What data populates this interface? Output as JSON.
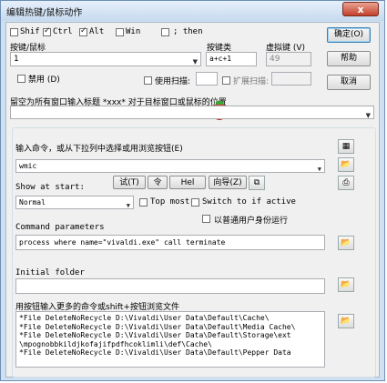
{
  "window": {
    "title": "编辑热键/鼠标动作",
    "close_glyph": "x"
  },
  "modifiers": {
    "shift": {
      "label": "Shif",
      "checked": false
    },
    "ctrl": {
      "label": "Ctrl",
      "checked": true
    },
    "alt": {
      "label": "Alt",
      "checked": true
    },
    "win": {
      "label": "Win",
      "checked": false
    },
    "extra": {
      "label": "; then",
      "checked": false
    }
  },
  "hotkey": {
    "label": "按键/鼠标",
    "value": "1"
  },
  "keyclass": {
    "label": "按键类",
    "value": "a+c+1"
  },
  "virtualkey": {
    "label": "虚拟键 (V)",
    "value": "49"
  },
  "disable": {
    "label": "禁用 (D)"
  },
  "use_scan": {
    "label": "使用扫描:"
  },
  "ext_scan": {
    "label": "扩展扫描:"
  },
  "buttons": {
    "ok": "确定(O)",
    "help": "帮助",
    "cancel": "取消"
  },
  "target": {
    "label": "留空为所有窗口输入标题 *xxx* 对于目标窗口或鼠标的位置",
    "value": ""
  },
  "command": {
    "label": "输入命令，或从下拉列中选择或用浏览按钮(E)",
    "value": "wmic"
  },
  "show": {
    "label": "Show at start:",
    "value": "Normal"
  },
  "tiny_buttons": {
    "test": "试(T)",
    "find_mid": "令",
    "help_short": "Hel",
    "wizard": "向导(Z)"
  },
  "top_most": {
    "label": "Top most"
  },
  "switch_if_active": {
    "label": "Switch to if active"
  },
  "run_as_user": {
    "label": "以普通用户身份运行"
  },
  "params": {
    "label": "Command parameters",
    "value": "process where name=\"vivaldi.exe\" call terminate"
  },
  "initial_folder": {
    "label": "Initial folder",
    "value": ""
  },
  "more_cmds": {
    "label": "用按钮输入更多的命令或shift+按钮浏览文件",
    "value": "*File DeleteNoRecycle D:\\Vivaldi\\User Data\\Default\\Cache\\\n*File DeleteNoRecycle D:\\Vivaldi\\User Data\\Default\\Media Cache\\\n*File DeleteNoRecycle D:\\Vivaldi\\User Data\\Default\\Storage\\ext\n\\mpognobbkildjkofajifpdfhcoklimli\\def\\Cache\\\n*File DeleteNoRecycle D:\\Vivaldi\\User Data\\Default\\Pepper Data"
  }
}
